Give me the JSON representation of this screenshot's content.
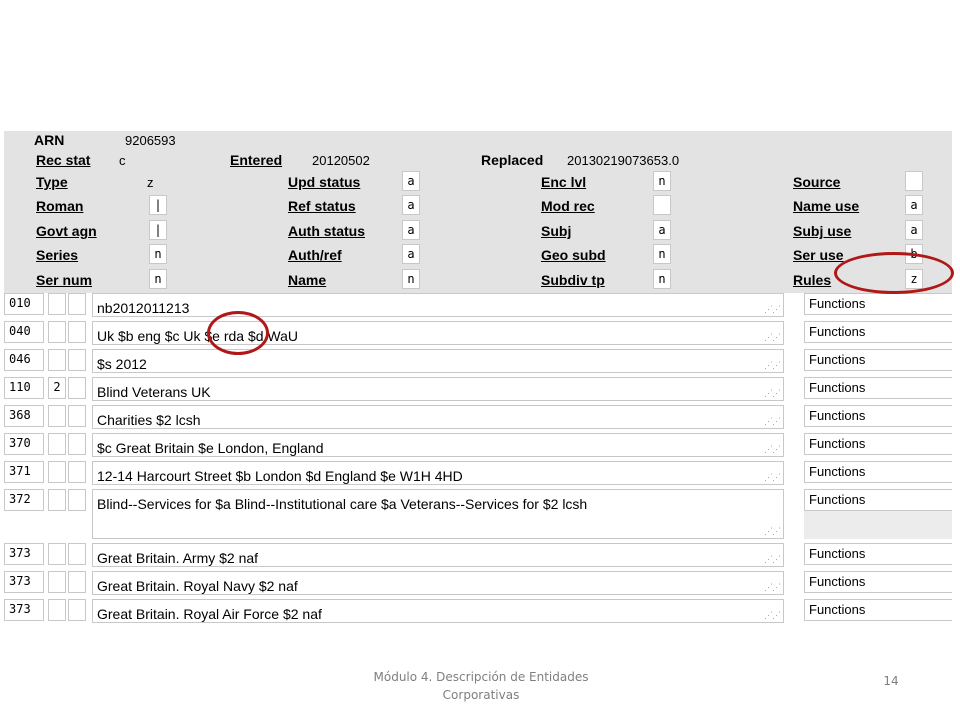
{
  "fixed_fields": {
    "arn": {
      "label": "ARN",
      "value": "9206593"
    },
    "rec_stat": {
      "label": "Rec stat",
      "value": "c"
    },
    "entered": {
      "label": "Entered",
      "value": "20120502"
    },
    "replaced": {
      "label": "Replaced",
      "value": "20130219073653.0"
    },
    "type": {
      "label": "Type",
      "value": "z"
    },
    "roman": {
      "label": "Roman",
      "value": "|"
    },
    "govt_agn": {
      "label": "Govt agn",
      "value": "|"
    },
    "series": {
      "label": "Series",
      "value": "n"
    },
    "ser_num": {
      "label": "Ser num",
      "value": "n"
    },
    "upd_status": {
      "label": "Upd status",
      "value": "a"
    },
    "ref_status": {
      "label": "Ref status",
      "value": "a"
    },
    "auth_status": {
      "label": "Auth status",
      "value": "a"
    },
    "auth_ref": {
      "label": "Auth/ref",
      "value": "a"
    },
    "name": {
      "label": "Name",
      "value": "n"
    },
    "enc_lvl": {
      "label": "Enc lvl",
      "value": "n"
    },
    "mod_rec": {
      "label": "Mod rec",
      "value": ""
    },
    "subj": {
      "label": "Subj",
      "value": "a"
    },
    "geo_subd": {
      "label": "Geo subd",
      "value": "n"
    },
    "subdiv_tp": {
      "label": "Subdiv tp",
      "value": "n"
    },
    "source": {
      "label": "Source",
      "value": ""
    },
    "name_use": {
      "label": "Name use",
      "value": "a"
    },
    "subj_use": {
      "label": "Subj use",
      "value": "a"
    },
    "ser_use": {
      "label": "Ser use",
      "value": "b"
    },
    "rules": {
      "label": "Rules",
      "value": "z"
    }
  },
  "functions_label": "Functions",
  "fields": [
    {
      "tag": "010",
      "ind1": "",
      "ind2": "",
      "content": "nb2012011213"
    },
    {
      "tag": "040",
      "ind1": "",
      "ind2": "",
      "content": "Uk $b eng $c Uk $e rda $d WaU"
    },
    {
      "tag": "046",
      "ind1": "",
      "ind2": "",
      "content": "$s 2012"
    },
    {
      "tag": "110",
      "ind1": "2",
      "ind2": "",
      "content": "Blind Veterans UK"
    },
    {
      "tag": "368",
      "ind1": "",
      "ind2": "",
      "content": "Charities $2 lcsh"
    },
    {
      "tag": "370",
      "ind1": "",
      "ind2": "",
      "content": "$c Great Britain $e London, England"
    },
    {
      "tag": "371",
      "ind1": "",
      "ind2": "",
      "content": "12-14 Harcourt Street $b London $d England $e W1H 4HD"
    },
    {
      "tag": "372",
      "ind1": "",
      "ind2": "",
      "content": "Blind--Services for $a Blind--Institutional care $a Veterans--Services for $2 lcsh"
    },
    {
      "tag": "373",
      "ind1": "",
      "ind2": "",
      "content": "Great Britain. Army $2 naf"
    },
    {
      "tag": "373",
      "ind1": "",
      "ind2": "",
      "content": "Great Britain. Royal Navy $2 naf"
    },
    {
      "tag": "373",
      "ind1": "",
      "ind2": "",
      "content": "Great Britain. Royal Air Force $2 naf"
    }
  ],
  "footer": {
    "text_line1": "Módulo 4. Descripción de Entidades",
    "text_line2": "Corporativas",
    "page_number": "14"
  },
  "colors": {
    "highlight": "#b01818",
    "header_bg": "#e3e3e3",
    "footer_text": "#7f7f7f"
  }
}
